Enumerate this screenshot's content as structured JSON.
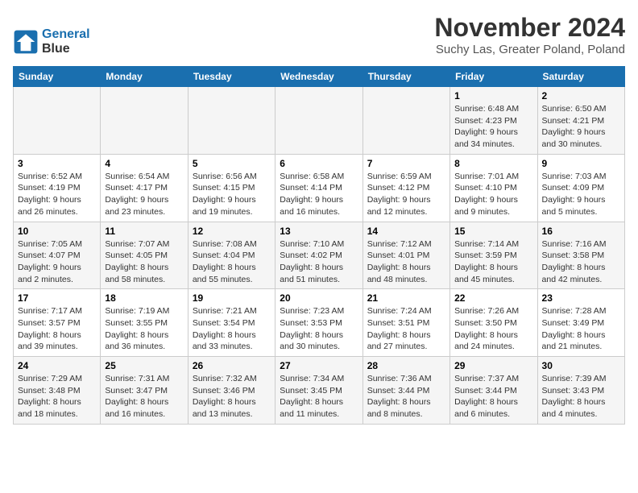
{
  "header": {
    "logo_line1": "General",
    "logo_line2": "Blue",
    "month_title": "November 2024",
    "location": "Suchy Las, Greater Poland, Poland"
  },
  "calendar": {
    "days_of_week": [
      "Sunday",
      "Monday",
      "Tuesday",
      "Wednesday",
      "Thursday",
      "Friday",
      "Saturday"
    ],
    "weeks": [
      [
        {
          "day": "",
          "info": ""
        },
        {
          "day": "",
          "info": ""
        },
        {
          "day": "",
          "info": ""
        },
        {
          "day": "",
          "info": ""
        },
        {
          "day": "",
          "info": ""
        },
        {
          "day": "1",
          "info": "Sunrise: 6:48 AM\nSunset: 4:23 PM\nDaylight: 9 hours\nand 34 minutes."
        },
        {
          "day": "2",
          "info": "Sunrise: 6:50 AM\nSunset: 4:21 PM\nDaylight: 9 hours\nand 30 minutes."
        }
      ],
      [
        {
          "day": "3",
          "info": "Sunrise: 6:52 AM\nSunset: 4:19 PM\nDaylight: 9 hours\nand 26 minutes."
        },
        {
          "day": "4",
          "info": "Sunrise: 6:54 AM\nSunset: 4:17 PM\nDaylight: 9 hours\nand 23 minutes."
        },
        {
          "day": "5",
          "info": "Sunrise: 6:56 AM\nSunset: 4:15 PM\nDaylight: 9 hours\nand 19 minutes."
        },
        {
          "day": "6",
          "info": "Sunrise: 6:58 AM\nSunset: 4:14 PM\nDaylight: 9 hours\nand 16 minutes."
        },
        {
          "day": "7",
          "info": "Sunrise: 6:59 AM\nSunset: 4:12 PM\nDaylight: 9 hours\nand 12 minutes."
        },
        {
          "day": "8",
          "info": "Sunrise: 7:01 AM\nSunset: 4:10 PM\nDaylight: 9 hours\nand 9 minutes."
        },
        {
          "day": "9",
          "info": "Sunrise: 7:03 AM\nSunset: 4:09 PM\nDaylight: 9 hours\nand 5 minutes."
        }
      ],
      [
        {
          "day": "10",
          "info": "Sunrise: 7:05 AM\nSunset: 4:07 PM\nDaylight: 9 hours\nand 2 minutes."
        },
        {
          "day": "11",
          "info": "Sunrise: 7:07 AM\nSunset: 4:05 PM\nDaylight: 8 hours\nand 58 minutes."
        },
        {
          "day": "12",
          "info": "Sunrise: 7:08 AM\nSunset: 4:04 PM\nDaylight: 8 hours\nand 55 minutes."
        },
        {
          "day": "13",
          "info": "Sunrise: 7:10 AM\nSunset: 4:02 PM\nDaylight: 8 hours\nand 51 minutes."
        },
        {
          "day": "14",
          "info": "Sunrise: 7:12 AM\nSunset: 4:01 PM\nDaylight: 8 hours\nand 48 minutes."
        },
        {
          "day": "15",
          "info": "Sunrise: 7:14 AM\nSunset: 3:59 PM\nDaylight: 8 hours\nand 45 minutes."
        },
        {
          "day": "16",
          "info": "Sunrise: 7:16 AM\nSunset: 3:58 PM\nDaylight: 8 hours\nand 42 minutes."
        }
      ],
      [
        {
          "day": "17",
          "info": "Sunrise: 7:17 AM\nSunset: 3:57 PM\nDaylight: 8 hours\nand 39 minutes."
        },
        {
          "day": "18",
          "info": "Sunrise: 7:19 AM\nSunset: 3:55 PM\nDaylight: 8 hours\nand 36 minutes."
        },
        {
          "day": "19",
          "info": "Sunrise: 7:21 AM\nSunset: 3:54 PM\nDaylight: 8 hours\nand 33 minutes."
        },
        {
          "day": "20",
          "info": "Sunrise: 7:23 AM\nSunset: 3:53 PM\nDaylight: 8 hours\nand 30 minutes."
        },
        {
          "day": "21",
          "info": "Sunrise: 7:24 AM\nSunset: 3:51 PM\nDaylight: 8 hours\nand 27 minutes."
        },
        {
          "day": "22",
          "info": "Sunrise: 7:26 AM\nSunset: 3:50 PM\nDaylight: 8 hours\nand 24 minutes."
        },
        {
          "day": "23",
          "info": "Sunrise: 7:28 AM\nSunset: 3:49 PM\nDaylight: 8 hours\nand 21 minutes."
        }
      ],
      [
        {
          "day": "24",
          "info": "Sunrise: 7:29 AM\nSunset: 3:48 PM\nDaylight: 8 hours\nand 18 minutes."
        },
        {
          "day": "25",
          "info": "Sunrise: 7:31 AM\nSunset: 3:47 PM\nDaylight: 8 hours\nand 16 minutes."
        },
        {
          "day": "26",
          "info": "Sunrise: 7:32 AM\nSunset: 3:46 PM\nDaylight: 8 hours\nand 13 minutes."
        },
        {
          "day": "27",
          "info": "Sunrise: 7:34 AM\nSunset: 3:45 PM\nDaylight: 8 hours\nand 11 minutes."
        },
        {
          "day": "28",
          "info": "Sunrise: 7:36 AM\nSunset: 3:44 PM\nDaylight: 8 hours\nand 8 minutes."
        },
        {
          "day": "29",
          "info": "Sunrise: 7:37 AM\nSunset: 3:44 PM\nDaylight: 8 hours\nand 6 minutes."
        },
        {
          "day": "30",
          "info": "Sunrise: 7:39 AM\nSunset: 3:43 PM\nDaylight: 8 hours\nand 4 minutes."
        }
      ]
    ]
  }
}
